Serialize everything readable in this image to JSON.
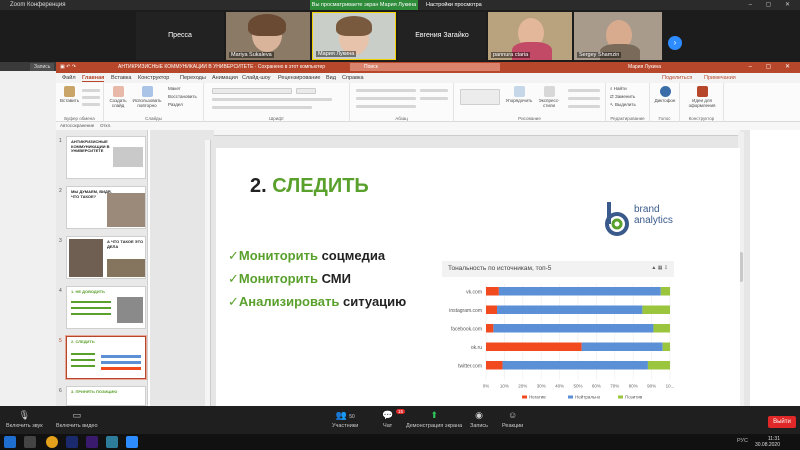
{
  "zoom_window": {
    "title": "Zoom Конференция",
    "share_banner": "Вы просматриваете экран Мария Лукина",
    "view_options": "Настройки просмотра"
  },
  "gallery": {
    "tiles": [
      {
        "name": "Пресса",
        "caption": ""
      },
      {
        "name": "",
        "caption": "Mariya Sukaleva"
      },
      {
        "name": "",
        "caption": "Мария Лукина"
      },
      {
        "name": "Евгения Загайко",
        "caption": ""
      },
      {
        "name": "",
        "caption": "pannura ctaria"
      },
      {
        "name": "",
        "caption": "Sergey Shamzin"
      }
    ],
    "next_arrow": "›"
  },
  "browser": {
    "tab_title": "Запись"
  },
  "powerpoint": {
    "doc_title": "АНТИКРИЗИСНЫЕ КОММУНИКАЦИИ В УНИВЕРСИТЕТЕ",
    "saved_state": "Сохранено в этот компьютер",
    "search_placeholder": "Поиск",
    "user": "Мария Лукина",
    "menu": [
      "Файл",
      "Главная",
      "Вставка",
      "Конструктор",
      "Переходы",
      "Анимация",
      "Слайд-шоу",
      "Рецензирование",
      "Вид",
      "Справка"
    ],
    "menu_right": [
      "Поделиться",
      "Примечания"
    ],
    "ribbon_groups": [
      {
        "label": "Буфер обмена",
        "buttons": [
          "Вставить"
        ]
      },
      {
        "label": "Слайды",
        "buttons": [
          "Создать слайд",
          "Использовать повторно"
        ]
      },
      {
        "label": "Шрифт",
        "buttons": []
      },
      {
        "label": "Абзац",
        "buttons": []
      },
      {
        "label": "Рисование",
        "buttons": [
          "Упорядочить",
          "Экспресс-стили"
        ]
      },
      {
        "label": "Редактирование",
        "buttons": [
          "Найти",
          "Заменить",
          "Выделить"
        ]
      },
      {
        "label": "Голос",
        "buttons": [
          "Диктофон"
        ]
      },
      {
        "label": "Конструктор",
        "buttons": [
          "Идеи для оформления"
        ]
      }
    ],
    "ribbon_misc": {
      "maket": "Макет",
      "restore": "Восстановить",
      "section": "Раздел"
    },
    "toolbar2": [
      "Автосохранение",
      "Откл."
    ]
  },
  "thumbnails": [
    {
      "num": "1",
      "title": "АНТИКРИЗИСНЫЕ КОММУНИКАЦИИ В УНИВЕРСИТЕТЕ"
    },
    {
      "num": "2",
      "title": "МЫ ДУМАЕМ, ВИДЯ, ЧТО ТАКОЕ?"
    },
    {
      "num": "3",
      "title": "А ЧТО ТАКОЕ ЭТО ДЕЛА"
    },
    {
      "num": "4",
      "title": "1. НЕ ДОВОДИТЬ"
    },
    {
      "num": "5",
      "title": "2. СЛЕДИТЬ"
    },
    {
      "num": "6",
      "title": "3. ПРИНЯТЬ ПОЗИЦИЮ"
    }
  ],
  "slide": {
    "heading_num": "2.",
    "heading_word": "СЛЕДИТЬ",
    "logo": {
      "line1": "brand",
      "line2": "analytics"
    },
    "bullets": [
      {
        "green": "✓Мониторить",
        "black": "соцмедиа"
      },
      {
        "green": "✓Мониторить",
        "black": "СМИ"
      },
      {
        "green": "✓Анализировать",
        "black": "ситуацию"
      }
    ]
  },
  "chart_data": {
    "type": "bar",
    "orientation": "horizontal",
    "stacked": true,
    "title": "Тональность по источникам, топ-5",
    "categories": [
      "vk.com",
      "instagram.com",
      "facebook.com",
      "ok.ru",
      "twitter.com"
    ],
    "series": [
      {
        "name": "Негатив",
        "color": "#f04a1e",
        "values": [
          7,
          6,
          4,
          52,
          9
        ]
      },
      {
        "name": "Нейтрально",
        "color": "#5b8fd6",
        "values": [
          88,
          79,
          87,
          44,
          79
        ]
      },
      {
        "name": "Позитив",
        "color": "#9bc53d",
        "values": [
          5,
          15,
          9,
          4,
          12
        ]
      }
    ],
    "xlim": [
      0,
      100
    ],
    "xticks": [
      "0%",
      "10%",
      "20%",
      "30%",
      "40%",
      "50%",
      "60%",
      "70%",
      "80%",
      "90%",
      "10..."
    ],
    "legend": "bottom"
  },
  "zoom_controls": {
    "audio": "Включить звук",
    "video": "Включить видео",
    "participants": "Участники",
    "participants_count": "50",
    "chat": "Чат",
    "chat_badge": "15",
    "share": "Демонстрация экрана",
    "record": "Запись",
    "reactions": "Реакции",
    "leave": "Выйти"
  },
  "taskbar": {
    "time": "11:31",
    "date": "30.08.2020",
    "lang": "РУС"
  }
}
